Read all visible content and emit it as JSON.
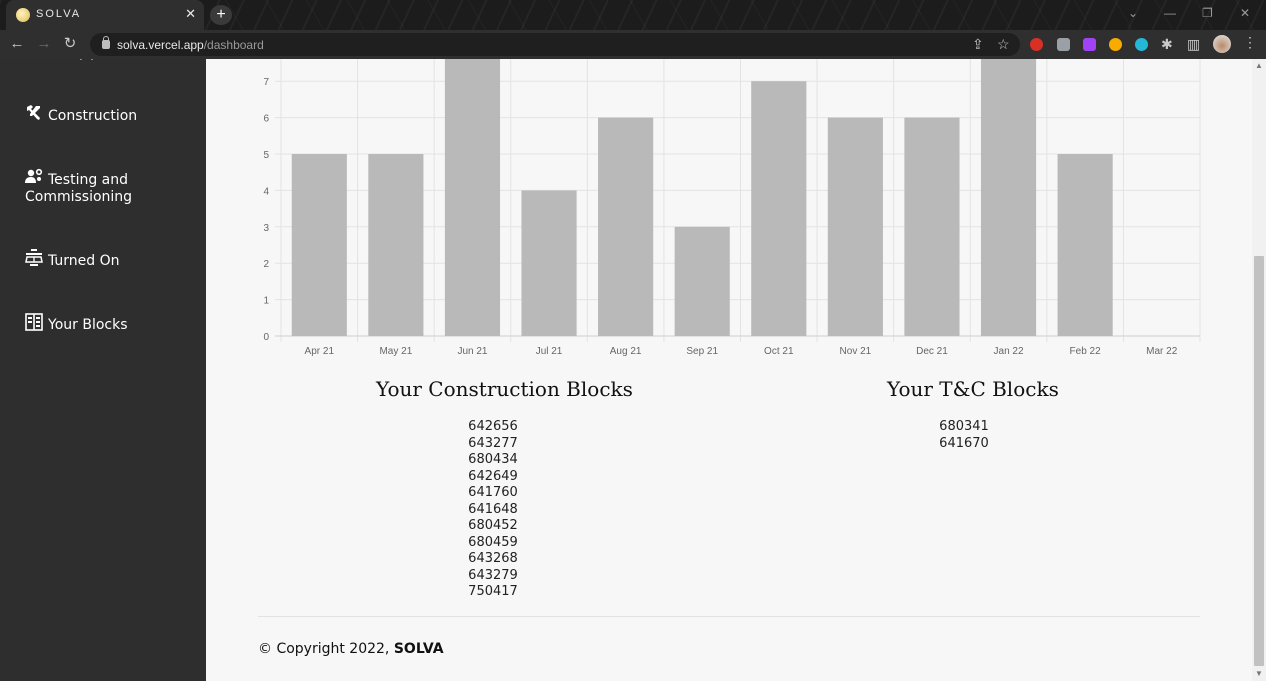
{
  "browser": {
    "tab_title": "SOLVA",
    "tab_close": "✕",
    "new_tab": "+",
    "url_domain": "solva.vercel.app",
    "url_path": "/dashboard"
  },
  "sidebar": {
    "items": [
      {
        "label": "Construction"
      },
      {
        "label_line1": "Testing and",
        "label_line2": "Commissioning"
      },
      {
        "label": "Turned On"
      },
      {
        "label": "Your Blocks"
      }
    ]
  },
  "chart_data": {
    "type": "bar",
    "categories": [
      "Apr 21",
      "May 21",
      "Jun 21",
      "Jul 21",
      "Aug 21",
      "Sep 21",
      "Oct 21",
      "Nov 21",
      "Dec 21",
      "Jan 22",
      "Feb 22",
      "Mar 22"
    ],
    "values": [
      5,
      5,
      8,
      4,
      6,
      3,
      7,
      6,
      6,
      8,
      5,
      0
    ],
    "yticks": [
      "0",
      "1",
      "2",
      "3",
      "4",
      "5",
      "6",
      "7"
    ],
    "ylim": [
      0,
      7.65
    ],
    "grid": true,
    "bar_color": "#b9b9b9"
  },
  "construction_blocks": {
    "title": "Your Construction Blocks",
    "items": [
      "642656",
      "643277",
      "680434",
      "642649",
      "641760",
      "641648",
      "680452",
      "680459",
      "643268",
      "643279",
      "750417"
    ]
  },
  "tc_blocks": {
    "title": "Your T&C Blocks",
    "items": [
      "680341",
      "641670"
    ]
  },
  "footer": {
    "prefix": "© Copyright 2022, ",
    "brand": "SOLVA"
  }
}
